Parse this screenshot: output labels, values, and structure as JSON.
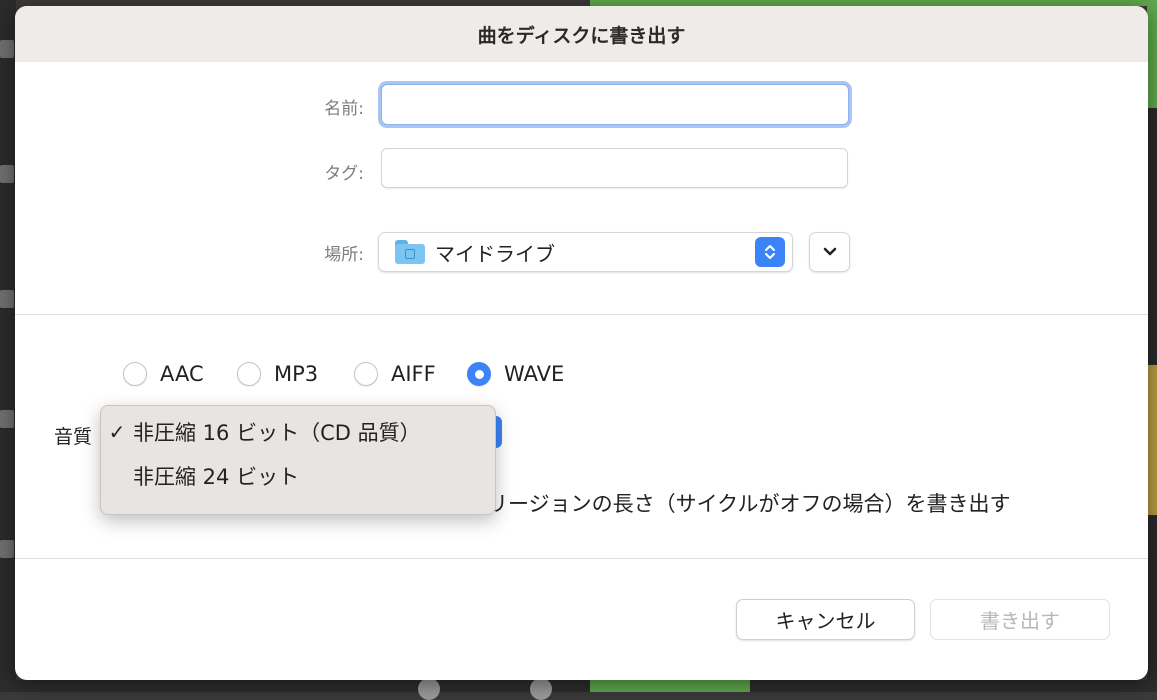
{
  "dialog": {
    "title": "曲をディスクに書き出す"
  },
  "form": {
    "name_label": "名前:",
    "name_value": "",
    "tag_label": "タグ:",
    "tag_value": "",
    "location_label": "場所:",
    "location_value": "マイドライブ"
  },
  "formats": [
    {
      "label": "AAC",
      "selected": false
    },
    {
      "label": "MP3",
      "selected": false
    },
    {
      "label": "AIFF",
      "selected": false
    },
    {
      "label": "WAVE",
      "selected": true
    }
  ],
  "quality": {
    "label": "音質",
    "options": [
      {
        "label": "非圧縮 16 ビット（CD 品質）",
        "checked": true
      },
      {
        "label": "非圧縮 24 ビット",
        "checked": false
      }
    ]
  },
  "cycle_option": {
    "label_visible": "リージョンの長さ（サイクルがオフの場合）を書き出す"
  },
  "buttons": {
    "cancel": "キャンセル",
    "export": "書き出す"
  },
  "colors": {
    "accent": "#3b83f6",
    "focus_ring": "#a9c6f2",
    "titlebar": "#efebe8",
    "menu_bg": "#e8e4e2"
  }
}
